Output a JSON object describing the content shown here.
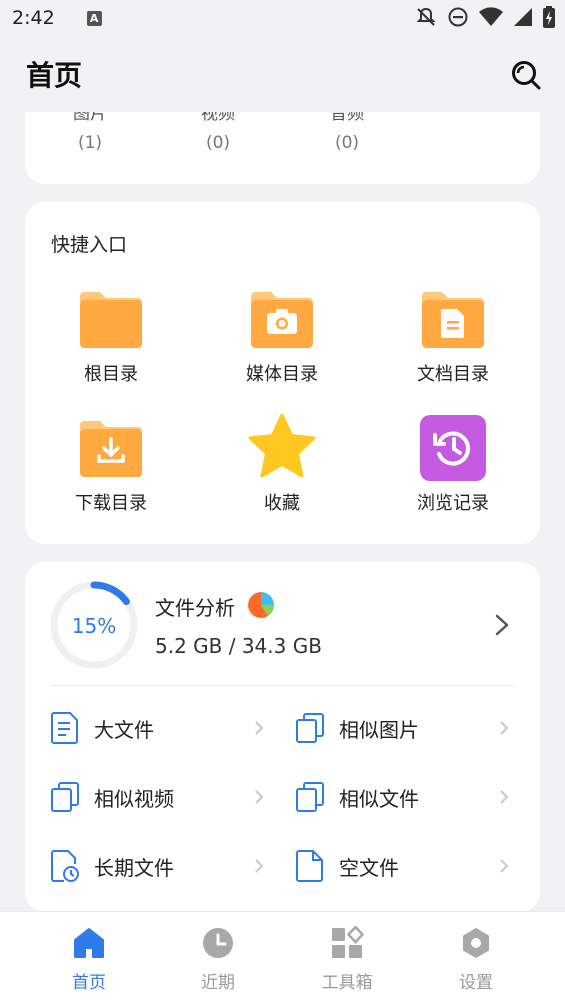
{
  "status": {
    "time": "2:42",
    "notice_icon": "A"
  },
  "header": {
    "title": "首页"
  },
  "categories": [
    {
      "label": "图片",
      "count": "(1)"
    },
    {
      "label": "视频",
      "count": "(0)"
    },
    {
      "label": "音频",
      "count": "(0)"
    }
  ],
  "quick": {
    "title": "快捷入口",
    "items": [
      {
        "label": "根目录",
        "icon": "folder-icon"
      },
      {
        "label": "媒体目录",
        "icon": "camera-folder-icon"
      },
      {
        "label": "文档目录",
        "icon": "document-folder-icon"
      },
      {
        "label": "下载目录",
        "icon": "download-folder-icon"
      },
      {
        "label": "收藏",
        "icon": "star-icon"
      },
      {
        "label": "浏览记录",
        "icon": "history-icon"
      }
    ]
  },
  "analysis": {
    "title": "文件分析",
    "percent": "15%",
    "percent_value": 15,
    "size": "5.2 GB / 34.3 GB"
  },
  "tools": [
    {
      "label": "大文件",
      "icon": "large-file-icon"
    },
    {
      "label": "相似图片",
      "icon": "similar-images-icon"
    },
    {
      "label": "相似视频",
      "icon": "similar-videos-icon"
    },
    {
      "label": "相似文件",
      "icon": "similar-files-icon"
    },
    {
      "label": "长期文件",
      "icon": "old-file-icon"
    },
    {
      "label": "空文件",
      "icon": "empty-file-icon"
    }
  ],
  "nav": [
    {
      "label": "首页",
      "icon": "home-icon",
      "active": true
    },
    {
      "label": "近期",
      "icon": "clock-icon",
      "active": false
    },
    {
      "label": "工具箱",
      "icon": "toolbox-icon",
      "active": false
    },
    {
      "label": "设置",
      "icon": "settings-icon",
      "active": false
    }
  ],
  "colors": {
    "accent": "#2F7BEA",
    "folder": "#FFA940",
    "history": "#C45AE0",
    "star": "#FFC81E"
  }
}
